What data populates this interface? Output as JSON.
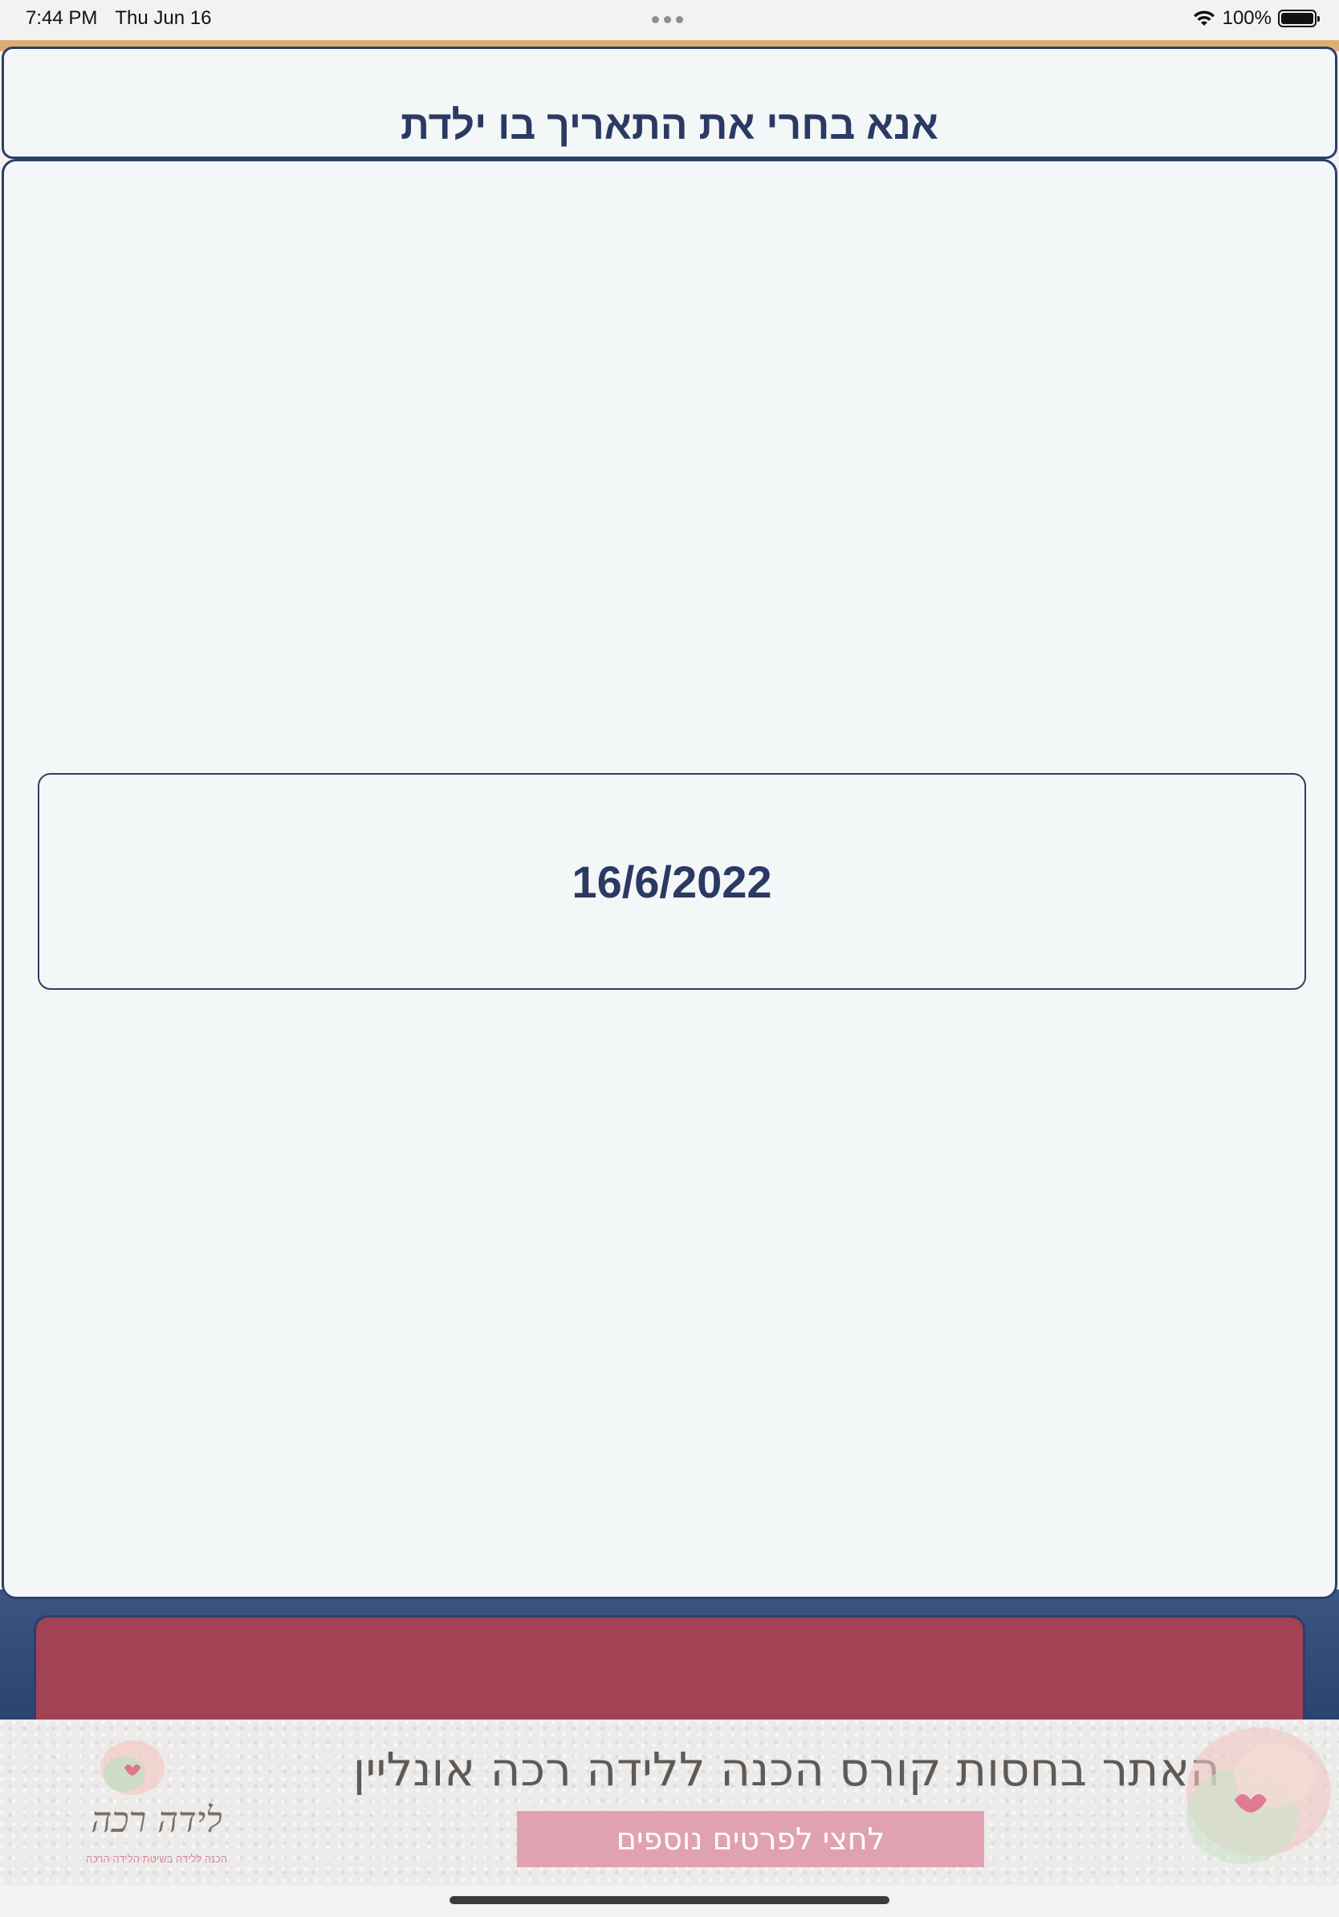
{
  "status_bar": {
    "time": "7:44 PM",
    "date": "Thu Jun 16",
    "battery_percent": "100%"
  },
  "header": {
    "title": "אנא בחרי את התאריך בו ילדת"
  },
  "date_picker": {
    "value": "16/6/2022"
  },
  "ad": {
    "headline": "האתר בחסות קורס הכנה ללידה רכה אונליין",
    "cta": "לחצי לפרטים נוספים",
    "logo_text": "לידה רכה",
    "logo_subtext": "הכנה ללידה בשיטת הלידה הרכה"
  },
  "colors": {
    "primary_navy": "#2c3f68",
    "button_red": "#a24255",
    "card_bg": "#f3f7f8",
    "accent_strip": "#dcae73",
    "ad_cta_pink": "#e0a2b2"
  }
}
